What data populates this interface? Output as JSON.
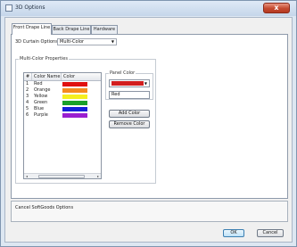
{
  "window": {
    "title": "3D Options",
    "close_glyph": "x"
  },
  "tabs": [
    {
      "label": "Front Drape Line",
      "active": true
    },
    {
      "label": "Back Drape Line",
      "active": false
    },
    {
      "label": "Hardware",
      "active": false
    }
  ],
  "curtain_options": {
    "label": "3D Curtain Options:",
    "selected": "Multi-Color"
  },
  "multicolor": {
    "group_title": "Multi-Color Properties",
    "columns": [
      "#",
      "Color Name",
      "Color"
    ],
    "rows": [
      {
        "num": "1",
        "name": "Red",
        "color": "#e01010"
      },
      {
        "num": "2",
        "name": "Orange",
        "color": "#f58a1f"
      },
      {
        "num": "3",
        "name": "Yellow",
        "color": "#f5ee20"
      },
      {
        "num": "4",
        "name": "Green",
        "color": "#1aa02a"
      },
      {
        "num": "5",
        "name": "Blue",
        "color": "#1620d8"
      },
      {
        "num": "6",
        "name": "Purple",
        "color": "#9a1ed0"
      }
    ]
  },
  "panel_color": {
    "group_title": "Panel Color",
    "selected_color": "#d21e1e",
    "name_value": "Red",
    "add_button": "Add Color",
    "remove_button": "Remove Color"
  },
  "description": "Cancel SoftGoods Options",
  "footer": {
    "ok": "OK",
    "cancel": "Cancel"
  },
  "icons": {
    "dropdown_arrow": "▼",
    "scroll_left": "◂",
    "scroll_right": "▸"
  }
}
